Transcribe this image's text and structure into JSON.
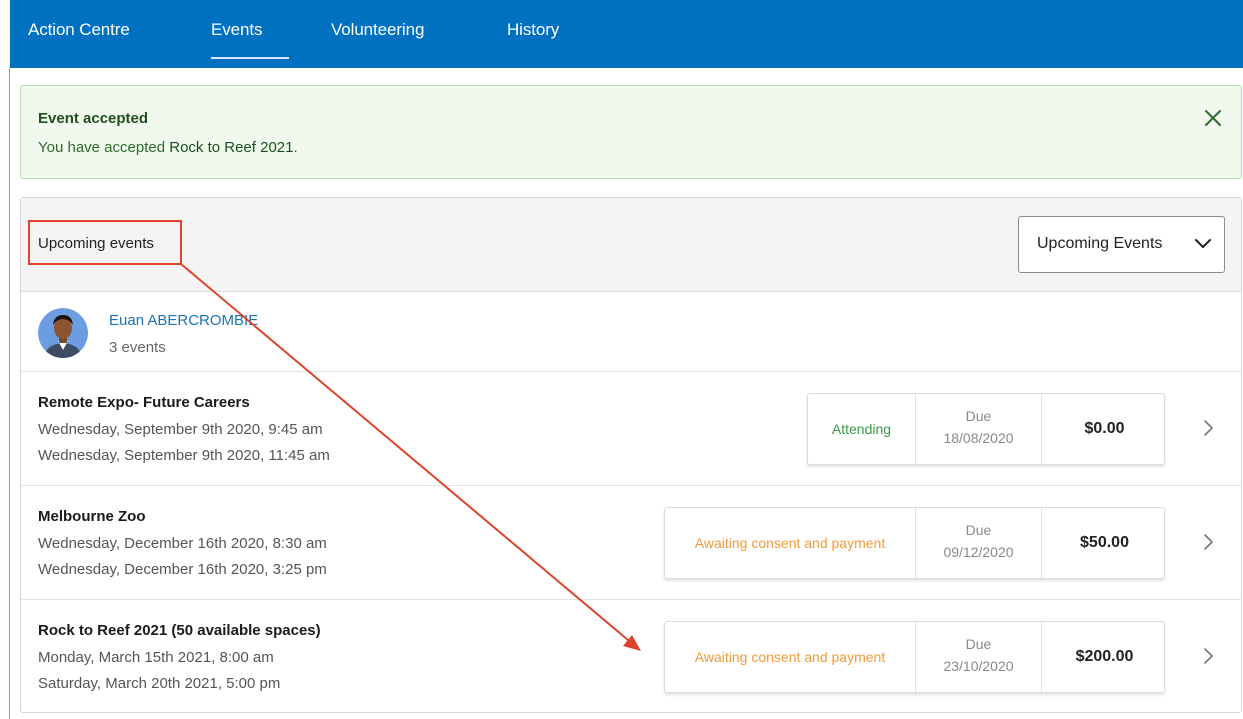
{
  "nav": {
    "tabs": [
      {
        "label": "Action Centre"
      },
      {
        "label": "Events"
      },
      {
        "label": "Volunteering"
      },
      {
        "label": "History"
      }
    ],
    "active_tab": "Events"
  },
  "alert": {
    "title": "Event accepted",
    "text_prefix": "You have accepted ",
    "event_name": "Rock to Reef 2021",
    "text_suffix": ".",
    "close_icon": "close-icon"
  },
  "panel": {
    "title": "Upcoming events",
    "filter": {
      "selected": "Upcoming Events",
      "icon": "chevron-down-icon"
    }
  },
  "person": {
    "name": "Euan ABERCROMBIE",
    "event_count": "3 events"
  },
  "events": [
    {
      "title": "Remote Expo- Future Careers",
      "start": "Wednesday, September 9th 2020, 9:45 am",
      "end": "Wednesday, September 9th 2020, 11:45 am",
      "status": "Attending",
      "status_color": "#3a9a4a",
      "due_label": "Due",
      "due_date": "18/08/2020",
      "amount": "$0.00"
    },
    {
      "title": "Melbourne Zoo",
      "start": "Wednesday, December 16th 2020, 8:30 am",
      "end": "Wednesday, December 16th 2020, 3:25 pm",
      "status": "Awaiting consent and payment",
      "status_color": "#f39a3a",
      "due_label": "Due",
      "due_date": "09/12/2020",
      "amount": "$50.00"
    },
    {
      "title": "Rock to Reef 2021 (50 available spaces)",
      "start": "Monday, March 15th 2021, 8:00 am",
      "end": "Saturday, March 20th 2021, 5:00 pm",
      "status": "Awaiting consent and payment",
      "status_color": "#f39a3a",
      "due_label": "Due",
      "due_date": "23/10/2020",
      "amount": "$200.00"
    }
  ],
  "colors": {
    "nav_bg": "#0070c0",
    "annotation": "#e0432b",
    "success_bg": "#f1f9ee"
  }
}
